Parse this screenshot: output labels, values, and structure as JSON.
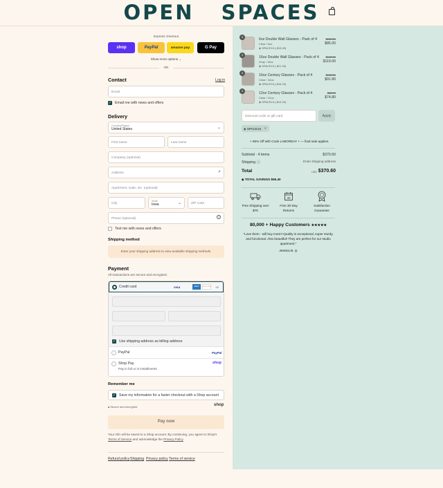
{
  "brand": {
    "logo_text": "OPEN SPACES"
  },
  "express": {
    "title": "Express checkout",
    "buttons": [
      "shop",
      "PayPal",
      "amazon pay",
      "G Pay"
    ],
    "more": "Show more options",
    "or": "OR"
  },
  "contact": {
    "heading": "Contact",
    "login": "Log in",
    "email_placeholder": "Email",
    "news": "Email me with news and offers"
  },
  "delivery": {
    "heading": "Delivery",
    "country_label": "Country/Region",
    "country_value": "United States",
    "first": "First name",
    "last": "Last name",
    "company": "Company (optional)",
    "address": "Address",
    "apt": "Apartment, suite, etc. (optional)",
    "city": "City",
    "state_label": "State",
    "state_value": "Iowa",
    "zip": "ZIP code",
    "phone": "Phone (optional)",
    "text_me": "Text me with news and offers"
  },
  "shipping": {
    "heading": "Shipping method",
    "note": "Enter your shipping address to view available shipping methods."
  },
  "payment": {
    "heading": "Payment",
    "sub": "All transactions are secure and encrypted.",
    "credit": "Credit card",
    "card_brands": [
      "VISA",
      "AMEX",
      "DISCOVER",
      "+3"
    ],
    "billing_same": "Use shipping address as billing address",
    "paypal": "PayPal",
    "paypal_logo": "PayPal",
    "shoppay": "Shop Pay",
    "shoppay_sub": "Pay in full or in installments",
    "shoppay_logo": "shop"
  },
  "remember": {
    "heading": "Remember me",
    "save": "Save my information for a faster checkout with a Shop account",
    "secure": "Secure and encrypted",
    "shop_logo": "shop"
  },
  "pay_now": "Pay now",
  "legal": {
    "line1": "Your info will be saved to a Shop account. By continuing, you agree to Shop's",
    "tos": "Terms of Service",
    "and": "and acknowledge the",
    "privacy": "Privacy Policy"
  },
  "footer_links": [
    "Refund policy",
    "Shipping",
    "Privacy policy",
    "Terms of service"
  ],
  "cart": {
    "items": [
      {
        "qty": "1",
        "name": "6oz Double Wall Glasses - Pack of 4",
        "variant": "Clear / 6oz",
        "discount": "SPACE15 (-$15.00)",
        "was": "$100.00",
        "price": "$85.00"
      },
      {
        "qty": "1",
        "name": "16oz Double Wall Glasses - Pack of 4",
        "variant": "Gray / 16oz",
        "discount": "SPACE15 (-$21.00)",
        "was": "$140.00",
        "price": "$119.00"
      },
      {
        "qty": "1",
        "name": "16oz Century Glasses - Pack of 4",
        "variant": "Clear / 16oz",
        "discount": "SPACE15 (-$16.20)",
        "was": "$108.00",
        "price": "$91.80"
      },
      {
        "qty": "1",
        "name": "12oz Century Glasses - Pack of 4",
        "variant": "Clear / 12oz",
        "discount": "SPACE15 (-$13.20)",
        "was": "$88.00",
        "price": "$74.80"
      }
    ],
    "discount_placeholder": "Discount code or gift card",
    "apply": "Apply",
    "applied_code": "SPACE15",
    "promo": "+ 65% Off with Code LABORDAY + — final sale applies.",
    "subtotal_label": "Subtotal · 4 items",
    "subtotal": "$370.60",
    "shipping_label": "Shipping",
    "shipping_value": "Enter shipping address",
    "total_label": "Total",
    "currency": "USD",
    "total": "$370.60",
    "savings_label": "TOTAL SAVINGS",
    "savings": "$65.40"
  },
  "perks": [
    {
      "line1": "Free Shipping over",
      "line2": "$75",
      "icon": "truck-icon"
    },
    {
      "line1": "Free 30-Day",
      "line2": "Returns",
      "icon": "calendar-icon"
    },
    {
      "line1": "Satisfaction",
      "line2": "Guarantee",
      "icon": "award-icon"
    }
  ],
  "calendar_num": "30",
  "reviews": {
    "heading": "80,000 + Happy Customers",
    "stars": "★★★★★",
    "quote1": "\"Love them - will buy more!! Quality is exceptional, super sturdy,",
    "quote2": "and functional. Also beautiful! They are perfect for our studio",
    "quote3": "apartment.\"",
    "author": "Jessica B."
  },
  "colors": {
    "teal": "#14484a",
    "panel": "#d5e8e1",
    "cream": "#fdf6ee"
  }
}
